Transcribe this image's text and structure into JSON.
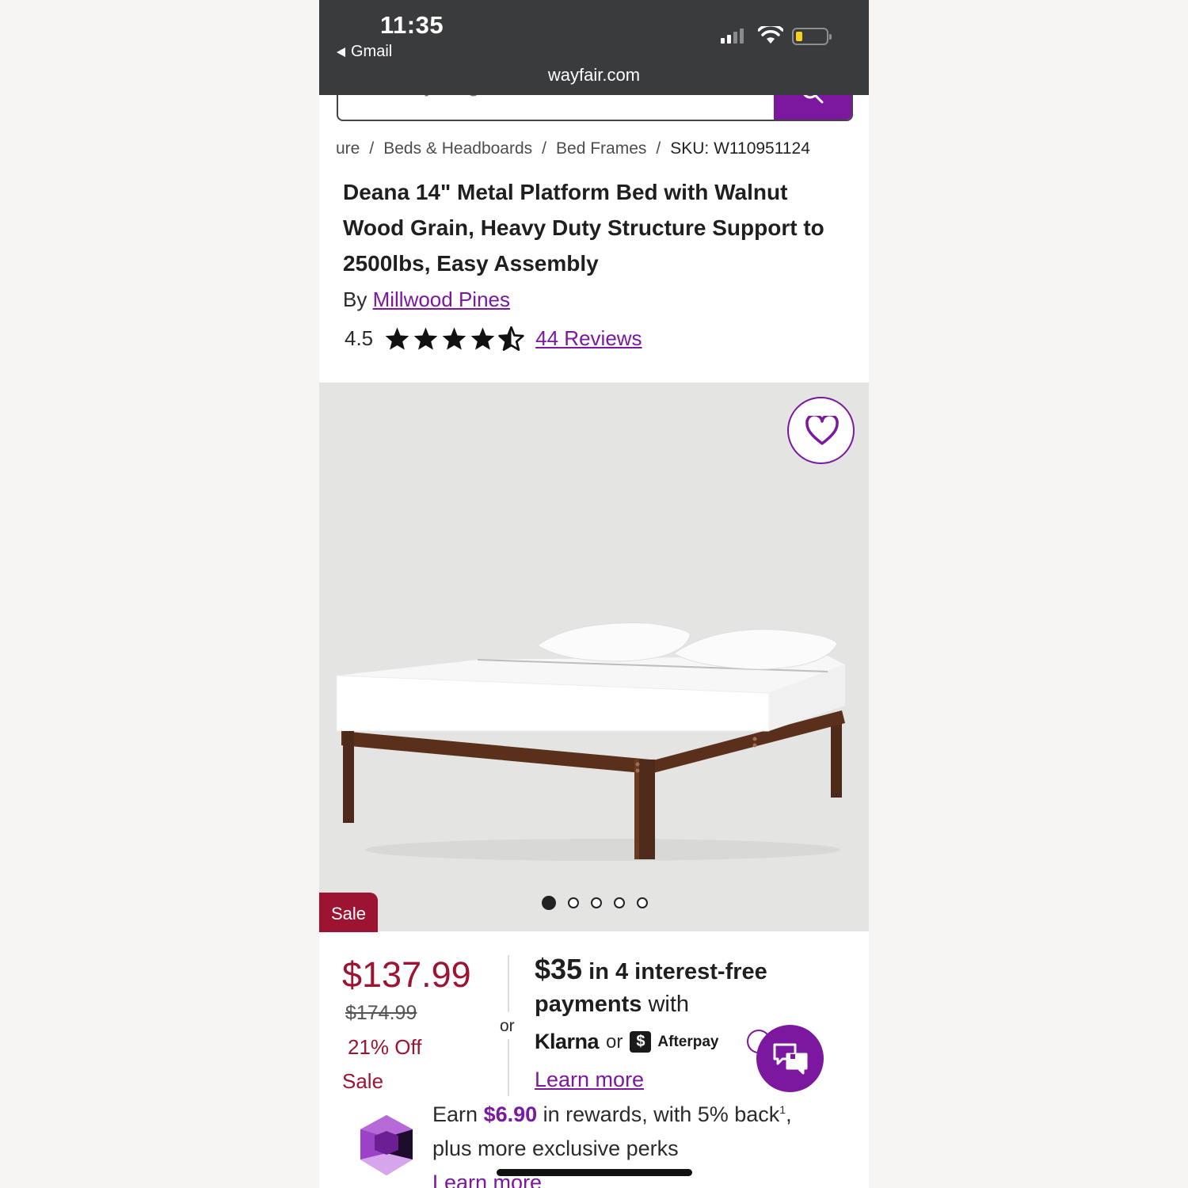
{
  "status_bar": {
    "time": "11:35",
    "back_app": "Gmail",
    "url": "wayfair.com"
  },
  "search": {
    "placeholder": "Find anything home..."
  },
  "breadcrumb": {
    "items": [
      "ure",
      "Beds & Headboards",
      "Bed Frames"
    ],
    "sku": "SKU: W110951124"
  },
  "product": {
    "title": "Deana 14\" Metal Platform Bed with Walnut Wood Grain, Heavy Duty Structure Support to 2500lbs, Easy Assembly",
    "by_prefix": "By",
    "brand": "Millwood Pines",
    "rating": "4.5",
    "rating_value": 4.5,
    "rating_max": 5,
    "reviews_link": "44 Reviews"
  },
  "gallery": {
    "sale_tag": "Sale",
    "image_count": 5,
    "active_index": 0
  },
  "pricing": {
    "price": "$137.99",
    "original_price": "$174.99",
    "discount": "21% Off",
    "sale_label": "Sale",
    "or": "or"
  },
  "financing": {
    "amount": "$35",
    "line1_rest_a": "in 4",
    "line1_rest_b": "interest-free",
    "line2_bold": "payments",
    "line2_rest": "with",
    "klarna": "Klarna",
    "or": "or",
    "afterpay_icon": "$",
    "afterpay": "Afterpay",
    "learn_more": "Learn more"
  },
  "rewards": {
    "earn": "Earn",
    "amount": "$6.90",
    "text": "in rewards, with 5% back",
    "footnote": "1",
    "comma": ",",
    "line2": "plus more exclusive perks",
    "learn_more": "Learn more"
  },
  "colors": {
    "brand_purple": "#7b189f",
    "sale_red": "#9d1433",
    "status_bar": "#3a3b3d",
    "image_bg": "#e4e4e3"
  },
  "icons": [
    "search-icon",
    "heart-icon",
    "star-icon",
    "half-star-icon",
    "chat-icon",
    "gem-icon",
    "wifi-icon",
    "signal-icon",
    "battery-icon"
  ]
}
